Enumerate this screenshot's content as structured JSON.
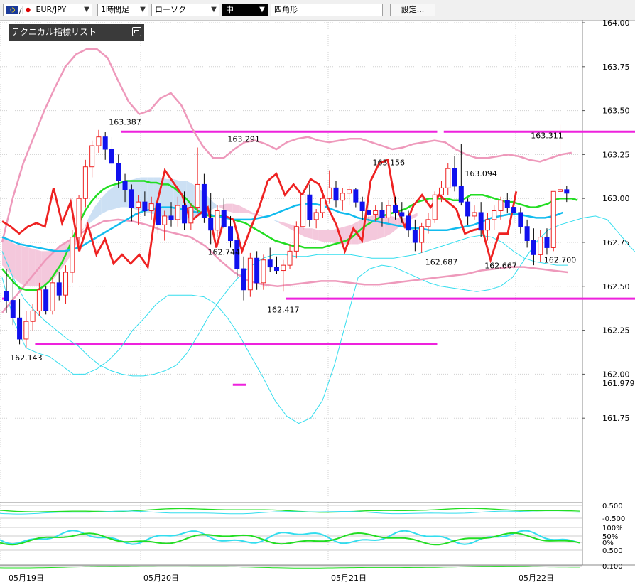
{
  "toolbar": {
    "symbol": "EUR/JPY",
    "timeframe": "1時間足",
    "chart_type": "ローソク",
    "line_weight": "中",
    "drawing_shape": "四角形",
    "settings_label": "設定..."
  },
  "indicator_panel": {
    "title": "テクニカル指標リスト"
  },
  "colors": {
    "bollinger_outer": "#33ddee",
    "bollinger_inner": "#ee99bb",
    "bollinger_mid": "#22dd22",
    "moving_average": "#11bbee",
    "spread_line": "#ee2222",
    "horizontal_lines": "#ee22dd",
    "bull_candle": "#ee2222",
    "bear_candle": "#1111ee",
    "cloud_bull": "#cce0f4",
    "cloud_bear": "#f4c8dc"
  },
  "chart_data": {
    "type": "candlestick",
    "pair": "EUR/JPY",
    "interval": "1時間足",
    "ylim": [
      161.5,
      164.0
    ],
    "y_ticks": [
      "164.00",
      "163.75",
      "163.50",
      "163.25",
      "163.00",
      "162.75",
      "162.50",
      "162.25",
      "162.00",
      "161.75"
    ],
    "current_price_label": "161.979",
    "x_labels": [
      "05月19日",
      "05月20日",
      "05月21日",
      "05月22日"
    ],
    "price_annotations": [
      {
        "t": 18,
        "value": "163.387"
      },
      {
        "t": 36,
        "value": "163.291"
      },
      {
        "t": 33,
        "value": "162.744"
      },
      {
        "t": 42,
        "value": "162.417"
      },
      {
        "t": 3,
        "value": "162.143"
      },
      {
        "t": 58,
        "value": "163.156"
      },
      {
        "t": 72,
        "value": "163.094"
      },
      {
        "t": 66,
        "value": "162.687"
      },
      {
        "t": 75,
        "value": "162.667"
      },
      {
        "t": 82,
        "value": "163.311"
      },
      {
        "t": 84,
        "value": "162.700"
      }
    ],
    "horizontal_lines": [
      {
        "price": 163.38,
        "t_from": 18,
        "t_to": 66
      },
      {
        "price": 163.38,
        "t_from": 67,
        "t_to": 97
      },
      {
        "price": 162.43,
        "t_from": 0,
        "t_to": 1
      },
      {
        "price": 162.43,
        "t_from": 43,
        "t_to": 97
      },
      {
        "price": 162.17,
        "t_from": 5,
        "t_to": 66
      },
      {
        "price": 161.94,
        "t_from": 35,
        "t_to": 37
      }
    ],
    "candles": [
      [
        162.47,
        162.6,
        162.35,
        162.42
      ],
      [
        162.42,
        162.55,
        162.28,
        162.32
      ],
      [
        162.32,
        162.43,
        162.17,
        162.2
      ],
      [
        162.2,
        162.36,
        162.15,
        162.3
      ],
      [
        162.3,
        162.4,
        162.25,
        162.36
      ],
      [
        162.36,
        162.52,
        162.33,
        162.48
      ],
      [
        162.48,
        162.5,
        162.34,
        162.36
      ],
      [
        162.36,
        162.55,
        162.34,
        162.52
      ],
      [
        162.52,
        162.58,
        162.42,
        162.45
      ],
      [
        162.45,
        162.62,
        162.4,
        162.58
      ],
      [
        162.58,
        162.82,
        162.52,
        162.78
      ],
      [
        162.78,
        163.02,
        162.74,
        163.0
      ],
      [
        163.0,
        163.22,
        162.95,
        163.18
      ],
      [
        163.18,
        163.33,
        163.12,
        163.3
      ],
      [
        163.3,
        163.39,
        163.26,
        163.35
      ],
      [
        163.35,
        163.38,
        163.22,
        163.28
      ],
      [
        163.28,
        163.35,
        163.16,
        163.2
      ],
      [
        163.2,
        163.25,
        163.06,
        163.1
      ],
      [
        163.1,
        163.14,
        162.98,
        163.05
      ],
      [
        163.05,
        163.08,
        162.87,
        162.95
      ],
      [
        162.95,
        163.02,
        162.85,
        162.98
      ],
      [
        162.98,
        163.04,
        162.9,
        162.93
      ],
      [
        162.93,
        163.01,
        162.88,
        162.97
      ],
      [
        162.97,
        163.0,
        162.8,
        162.85
      ],
      [
        162.85,
        162.93,
        162.76,
        162.9
      ],
      [
        162.9,
        162.98,
        162.84,
        162.88
      ],
      [
        162.88,
        163.01,
        162.84,
        162.96
      ],
      [
        162.96,
        163.04,
        162.82,
        162.86
      ],
      [
        162.86,
        162.97,
        162.82,
        162.95
      ],
      [
        162.95,
        163.29,
        162.92,
        163.08
      ],
      [
        163.08,
        163.14,
        162.86,
        162.89
      ],
      [
        162.89,
        163.03,
        162.74,
        162.82
      ],
      [
        162.82,
        162.96,
        162.78,
        162.93
      ],
      [
        162.93,
        163.0,
        162.83,
        162.84
      ],
      [
        162.84,
        162.9,
        162.72,
        162.76
      ],
      [
        162.76,
        162.78,
        162.55,
        162.6
      ],
      [
        162.6,
        162.67,
        162.42,
        162.48
      ],
      [
        162.48,
        162.69,
        162.44,
        162.66
      ],
      [
        162.66,
        162.7,
        162.48,
        162.52
      ],
      [
        162.52,
        162.68,
        162.48,
        162.65
      ],
      [
        162.65,
        162.72,
        162.58,
        162.61
      ],
      [
        162.61,
        162.67,
        162.57,
        162.59
      ],
      [
        162.59,
        162.65,
        162.47,
        162.62
      ],
      [
        162.62,
        162.74,
        162.6,
        162.7
      ],
      [
        162.7,
        162.87,
        162.66,
        162.84
      ],
      [
        162.84,
        163.06,
        162.82,
        163.02
      ],
      [
        163.02,
        163.08,
        162.84,
        162.88
      ],
      [
        162.88,
        162.94,
        162.83,
        162.92
      ],
      [
        162.92,
        163.05,
        162.89,
        163.0
      ],
      [
        163.0,
        163.16,
        162.97,
        163.06
      ],
      [
        163.06,
        163.1,
        162.95,
        162.99
      ],
      [
        162.99,
        163.06,
        162.93,
        163.03
      ],
      [
        163.03,
        163.07,
        162.96,
        163.05
      ],
      [
        163.05,
        163.06,
        162.95,
        162.98
      ],
      [
        162.98,
        163.01,
        162.88,
        162.93
      ],
      [
        162.93,
        162.97,
        162.86,
        162.91
      ],
      [
        162.91,
        162.96,
        162.87,
        162.93
      ],
      [
        162.93,
        162.98,
        162.84,
        162.89
      ],
      [
        162.89,
        162.99,
        162.86,
        162.96
      ],
      [
        162.96,
        163.01,
        162.88,
        162.92
      ],
      [
        162.92,
        162.98,
        162.86,
        162.9
      ],
      [
        162.9,
        162.93,
        162.78,
        162.82
      ],
      [
        162.82,
        162.88,
        162.7,
        162.75
      ],
      [
        162.75,
        162.86,
        162.69,
        162.84
      ],
      [
        162.84,
        162.92,
        162.8,
        162.88
      ],
      [
        162.88,
        163.04,
        162.86,
        163.02
      ],
      [
        163.02,
        163.1,
        162.98,
        163.06
      ],
      [
        163.06,
        163.2,
        163.02,
        163.17
      ],
      [
        163.17,
        163.24,
        163.04,
        163.07
      ],
      [
        163.07,
        163.31,
        162.96,
        162.98
      ],
      [
        162.98,
        163.0,
        162.85,
        162.9
      ],
      [
        162.9,
        162.96,
        162.88,
        162.92
      ],
      [
        162.92,
        162.98,
        162.78,
        162.82
      ],
      [
        162.82,
        162.92,
        162.76,
        162.88
      ],
      [
        162.88,
        162.96,
        162.82,
        162.93
      ],
      [
        162.93,
        163.01,
        162.88,
        162.99
      ],
      [
        162.99,
        163.03,
        162.92,
        162.95
      ],
      [
        162.95,
        163.0,
        162.86,
        162.92
      ],
      [
        162.92,
        162.95,
        162.8,
        162.84
      ],
      [
        162.84,
        162.88,
        162.72,
        162.76
      ],
      [
        162.76,
        162.83,
        162.62,
        162.68
      ],
      [
        162.68,
        162.82,
        162.64,
        162.78
      ],
      [
        162.78,
        162.83,
        162.68,
        162.72
      ],
      [
        162.72,
        163.04,
        162.7,
        163.04
      ],
      [
        163.04,
        163.42,
        162.99,
        163.05
      ],
      [
        163.05,
        163.07,
        162.98,
        163.03
      ]
    ],
    "series": [
      {
        "values": [
          162.55,
          162.3,
          162.15,
          162.12,
          162.1,
          162.05,
          162.0,
          162.0,
          162.03,
          162.08,
          162.15,
          162.25,
          162.32,
          162.4,
          162.45,
          162.45,
          162.45,
          162.44,
          162.4,
          162.32,
          162.22,
          162.1,
          161.98,
          161.85,
          161.76,
          161.72,
          161.75,
          161.85,
          162.05,
          162.3,
          162.55,
          162.6,
          162.62,
          162.61,
          162.58,
          162.55,
          162.52,
          162.5,
          162.49,
          162.48,
          162.47,
          162.48,
          162.5,
          162.55,
          162.65,
          162.75,
          162.82,
          162.85,
          162.87,
          162.89,
          162.9,
          162.88,
          162.8,
          162.72,
          162.65,
          162.62,
          162.63,
          162.65,
          162.68,
          162.66,
          162.63,
          162.58,
          162.56,
          162.55,
          162.53,
          162.51,
          162.5,
          162.5,
          162.49,
          162.48,
          162.48,
          162.49,
          162.49,
          162.5,
          162.48,
          162.47,
          162.48,
          162.49,
          162.5
        ]
      },
      {
        "values": [
          162.8,
          163.05,
          163.25,
          163.4,
          163.55,
          163.68,
          163.8,
          163.87,
          163.9,
          163.9,
          163.85,
          163.72,
          163.6,
          163.53,
          163.55,
          163.62,
          163.65,
          163.58,
          163.45,
          163.35,
          163.28,
          163.28,
          163.33,
          163.37,
          163.38,
          163.36,
          163.33,
          163.37,
          163.39,
          163.4,
          163.38,
          163.37,
          163.38,
          163.39,
          163.39,
          163.37,
          163.35,
          163.33,
          163.34,
          163.36,
          163.37,
          163.38,
          163.37,
          163.33,
          163.3,
          163.28,
          163.28,
          163.29,
          163.3,
          163.29,
          163.27,
          163.26,
          163.28,
          163.3,
          163.31
        ]
      },
      {
        "values": [
          162.7,
          162.55,
          162.43,
          162.36,
          162.3,
          162.25,
          162.2,
          162.16,
          162.1,
          162.05,
          162.02,
          162.0,
          161.99,
          161.99,
          162.0,
          162.02,
          162.05,
          162.12,
          162.22,
          162.33,
          162.42,
          162.5,
          162.57,
          162.62,
          162.66,
          162.68,
          162.68,
          162.67,
          162.67,
          162.68,
          162.68,
          162.68,
          162.68,
          162.67,
          162.66,
          162.66,
          162.66,
          162.67,
          162.68,
          162.7,
          162.72,
          162.74,
          162.76,
          162.78,
          162.79,
          162.78,
          162.75,
          162.7,
          162.66,
          162.64,
          162.63,
          162.62,
          162.62
        ]
      },
      {
        "values": [
          162.95,
          163.05,
          163.15,
          163.25,
          163.33,
          163.38,
          163.43,
          163.47,
          163.48,
          163.47,
          163.45,
          163.42,
          163.4,
          163.38,
          163.33,
          163.25,
          163.18,
          163.13,
          163.11,
          163.1,
          163.11,
          163.12,
          163.13,
          163.13,
          163.12,
          163.11,
          163.11,
          163.12,
          163.13,
          163.14,
          163.15,
          163.16,
          163.17,
          163.19,
          163.2,
          163.21,
          163.21,
          163.2,
          163.19,
          163.18
        ]
      },
      {
        "values": [
          162.62,
          162.58,
          162.54,
          162.51,
          162.5,
          162.5,
          162.5,
          162.52,
          162.55,
          162.6,
          162.65,
          162.72,
          162.8,
          162.88,
          162.95,
          163.0,
          163.04,
          163.07,
          163.09,
          163.1,
          163.11,
          163.12,
          163.12,
          163.12,
          163.12,
          163.11,
          163.11,
          163.1,
          163.1,
          163.08,
          163.05,
          163.02,
          162.98,
          162.95,
          162.93,
          162.92,
          162.92,
          162.92,
          162.91,
          162.9,
          162.89,
          162.88,
          162.86,
          162.84,
          162.82,
          162.8,
          162.78,
          162.77,
          162.76,
          162.75,
          162.75,
          162.74,
          162.74,
          162.74,
          162.74,
          162.75,
          162.76,
          162.77,
          162.78,
          162.8,
          162.83,
          162.86,
          162.88,
          162.9,
          162.92,
          162.93,
          162.94,
          162.95,
          162.96,
          162.98,
          163.0,
          163.01,
          163.02,
          163.02,
          163.02,
          163.02,
          163.01,
          163.01,
          163.02,
          163.04,
          163.04,
          163.04,
          163.03,
          163.02,
          163.01,
          163.0,
          163.0,
          162.99,
          162.98,
          162.97,
          162.97,
          162.98,
          162.99,
          163.01,
          163.02,
          163.02,
          163.02,
          163.01
        ]
      },
      {
        "values": [
          162.78,
          162.76,
          162.74,
          162.73,
          162.72,
          162.71,
          162.7,
          162.7,
          162.71,
          162.73,
          162.76,
          162.79,
          162.82,
          162.85,
          162.88,
          162.91,
          162.93,
          162.94,
          162.95,
          162.95,
          162.94,
          162.93,
          162.92,
          162.91,
          162.9,
          162.89,
          162.88,
          162.88,
          162.88,
          162.89,
          162.9,
          162.92,
          162.94,
          162.96,
          162.97,
          162.97,
          162.96,
          162.94,
          162.92,
          162.91,
          162.89,
          162.88,
          162.87,
          162.86,
          162.85,
          162.84,
          162.83,
          162.83,
          162.82,
          162.82,
          162.82,
          162.83,
          162.84,
          162.85,
          162.87,
          162.89,
          162.9,
          162.91,
          162.91,
          162.9,
          162.89,
          162.89,
          162.9,
          162.92
        ]
      },
      {
        "values": [
          162.87,
          162.84,
          162.8,
          162.84,
          162.86,
          162.84,
          163.06,
          162.86,
          162.98,
          162.7,
          162.85,
          162.68,
          162.77,
          162.63,
          162.68,
          162.63,
          162.68,
          162.61,
          162.96,
          163.16,
          163.09,
          163.02,
          162.87,
          162.91,
          162.95,
          162.72,
          162.9,
          162.88,
          162.7,
          162.83,
          162.95,
          163.1,
          163.14,
          163.02,
          163.08,
          163.02,
          163.11,
          163.08,
          162.95,
          162.85,
          162.7,
          162.83,
          162.76,
          163.1,
          163.2,
          163.22,
          162.95,
          162.84,
          162.96,
          163.02,
          162.95,
          163.02,
          162.98,
          162.94,
          162.8,
          162.82,
          162.83,
          162.65,
          162.8,
          162.8,
          163.04
        ]
      }
    ],
    "oscillator_labels": [
      "0.500",
      "-0.500",
      "100%",
      "50%",
      "0%",
      "0.500",
      "0.100"
    ]
  }
}
